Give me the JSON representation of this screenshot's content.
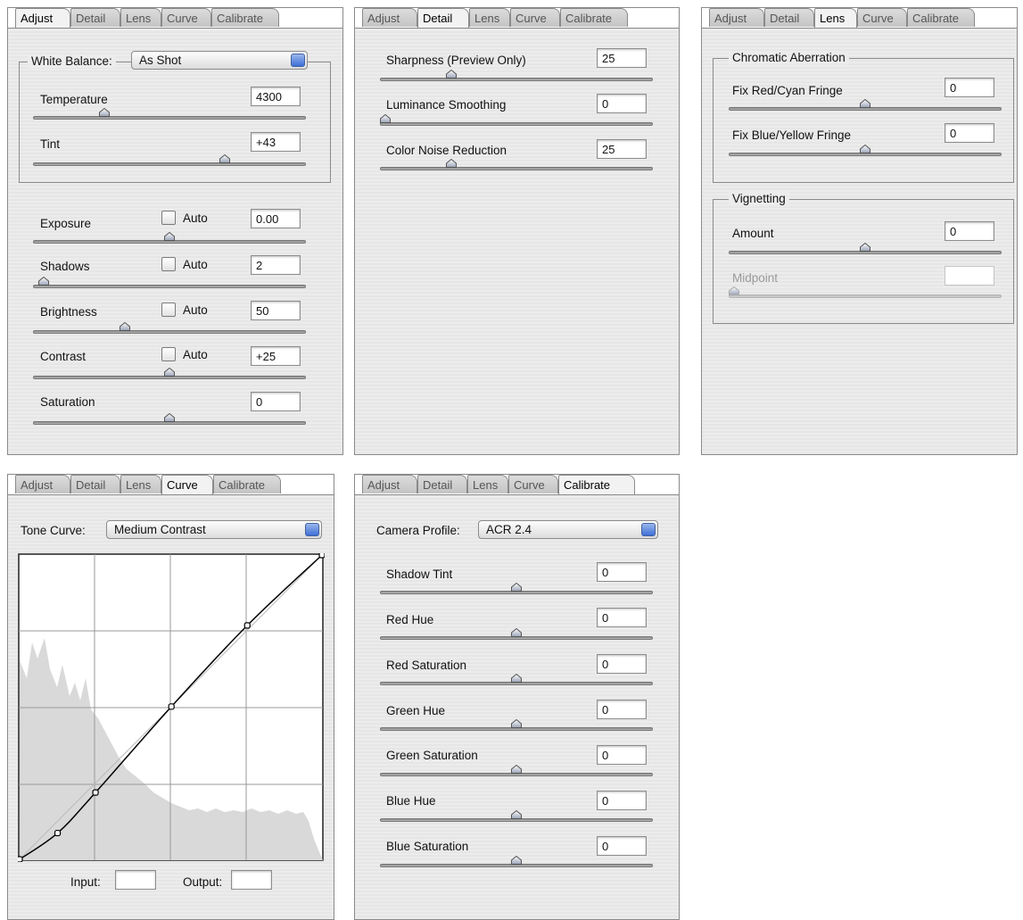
{
  "tabs": [
    "Adjust",
    "Detail",
    "Lens",
    "Curve",
    "Calibrate"
  ],
  "adjust": {
    "white_balance_label": "White Balance:",
    "white_balance_value": "As Shot",
    "auto_label": "Auto",
    "temperature": {
      "label": "Temperature",
      "value": "4300",
      "level": 0.25
    },
    "tint": {
      "label": "Tint",
      "value": "+43",
      "level": 0.71
    },
    "exposure": {
      "label": "Exposure",
      "value": "0.00",
      "level": 0.5
    },
    "shadows": {
      "label": "Shadows",
      "value": "2",
      "level": 0.02
    },
    "brightness": {
      "label": "Brightness",
      "value": "50",
      "level": 0.33
    },
    "contrast": {
      "label": "Contrast",
      "value": "+25",
      "level": 0.5
    },
    "saturation": {
      "label": "Saturation",
      "value": "0",
      "level": 0.5
    }
  },
  "detail": {
    "sharpness": {
      "label": "Sharpness  (Preview Only)",
      "value": "25",
      "level": 0.25
    },
    "luminance": {
      "label": "Luminance Smoothing",
      "value": "0",
      "level": 0.0
    },
    "color_noise": {
      "label": "Color Noise Reduction",
      "value": "25",
      "level": 0.25
    }
  },
  "lens": {
    "chromatic_title": "Chromatic Aberration",
    "fix_red": {
      "label": "Fix Red/Cyan Fringe",
      "value": "0",
      "level": 0.5
    },
    "fix_blue": {
      "label": "Fix Blue/Yellow Fringe",
      "value": "0",
      "level": 0.5
    },
    "vignetting_title": "Vignetting",
    "amount": {
      "label": "Amount",
      "value": "0",
      "level": 0.5
    },
    "midpoint": {
      "label": "Midpoint",
      "value": "",
      "level": 0.0
    }
  },
  "curve": {
    "tone_curve_label": "Tone Curve:",
    "tone_curve_value": "Medium Contrast",
    "input_label": "Input:",
    "output_label": "Output:",
    "input_value": "",
    "output_value": "",
    "points": [
      [
        0,
        0
      ],
      [
        32,
        22
      ],
      [
        64,
        56
      ],
      [
        128,
        128
      ],
      [
        192,
        196
      ],
      [
        255,
        255
      ]
    ]
  },
  "calibrate": {
    "camera_profile_label": "Camera Profile:",
    "camera_profile_value": "ACR 2.4",
    "shadow_tint": {
      "label": "Shadow Tint",
      "value": "0",
      "level": 0.5
    },
    "red_hue": {
      "label": "Red Hue",
      "value": "0",
      "level": 0.5
    },
    "red_saturation": {
      "label": "Red Saturation",
      "value": "0",
      "level": 0.5
    },
    "green_hue": {
      "label": "Green Hue",
      "value": "0",
      "level": 0.5
    },
    "green_saturation": {
      "label": "Green Saturation",
      "value": "0",
      "level": 0.5
    },
    "blue_hue": {
      "label": "Blue Hue",
      "value": "0",
      "level": 0.5
    },
    "blue_saturation": {
      "label": "Blue Saturation",
      "value": "0",
      "level": 0.5
    }
  }
}
